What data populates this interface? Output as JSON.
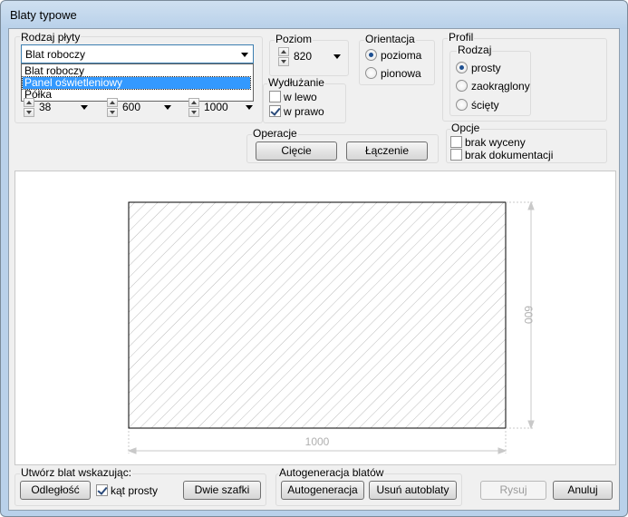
{
  "window": {
    "title": "Blaty typowe"
  },
  "rodzaj": {
    "label": "Rodzaj płyty",
    "selected": "Blat roboczy",
    "options": [
      "Blat roboczy",
      "Panel oświetleniowy",
      "Półka"
    ]
  },
  "dims": {
    "values": [
      "38",
      "600",
      "1000"
    ]
  },
  "poziom": {
    "label": "Poziom",
    "value": "820"
  },
  "orientacja": {
    "label": "Orientacja",
    "options": [
      "pozioma",
      "pionowa"
    ],
    "selected": "pozioma"
  },
  "profil": {
    "label": "Profil",
    "rodzaj_label": "Rodzaj",
    "options": [
      "prosty",
      "zaokrąglony",
      "ścięty"
    ],
    "selected": "prosty"
  },
  "wydluzanie": {
    "label": "Wydłużanie",
    "options": [
      {
        "label": "w lewo",
        "checked": false
      },
      {
        "label": "w prawo",
        "checked": true
      }
    ]
  },
  "operacje": {
    "label": "Operacje",
    "buttons": [
      "Cięcie",
      "Łączenie"
    ]
  },
  "opcje": {
    "label": "Opcje",
    "options": [
      {
        "label": "brak wyceny",
        "checked": false
      },
      {
        "label": "brak dokumentacji",
        "checked": false
      }
    ]
  },
  "drawing": {
    "width_label": "1000",
    "height_label": "600"
  },
  "utworz": {
    "label": "Utwórz blat wskazując:",
    "button1": "Odległość",
    "check_label": "kąt prosty",
    "check_checked": true,
    "button2": "Dwie szafki"
  },
  "autogen": {
    "label": "Autogeneracja blatów",
    "button1": "Autogeneracja",
    "button2": "Usuń autoblaty"
  },
  "footer": {
    "rysuj": "Rysuj",
    "anuluj": "Anuluj"
  }
}
